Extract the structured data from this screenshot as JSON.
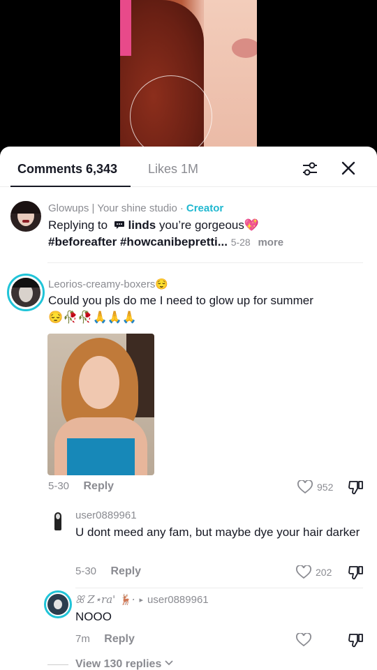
{
  "sheet": {
    "tabs": {
      "comments": "Comments 6,343",
      "likes": "Likes 1M"
    }
  },
  "comments": [
    {
      "username": "Glowups | Your shine studio",
      "dot": "·",
      "badge": "Creator",
      "replying_prefix": "Replying to",
      "reply_target": "linds",
      "text": "you’re gorgeous💖",
      "tags": "#beforeafter #howcanibepretti...",
      "date": "5-28",
      "more": "more"
    },
    {
      "username": "Leorios-creamy-boxers😌",
      "text": "Could you pls do me I need to glow up for summer",
      "emojis": "😔🥀🥀🙏🙏🙏",
      "date": "5-30",
      "reply_label": "Reply",
      "likes": "952"
    }
  ],
  "replies": [
    {
      "username": "user0889961",
      "text": "U dont meed any fam, but maybe dye your hair darker",
      "date": "5-30",
      "reply_label": "Reply",
      "likes": "202"
    },
    {
      "username": "ꕤ Z⋆ra' 🦌·",
      "arrow": "▸",
      "reply_to": "user0889961",
      "text": "NOOO",
      "date": "7m",
      "reply_label": "Reply",
      "likes": ""
    }
  ],
  "view_replies": "View 130 replies",
  "colors": {
    "accent": "#20b8d0",
    "text": "#161823",
    "muted": "#8a8b91"
  },
  "icons": [
    "filter-icon",
    "close-icon",
    "heart-icon",
    "dislike-icon",
    "chevron-down-icon",
    "speech-bubble-icon"
  ]
}
